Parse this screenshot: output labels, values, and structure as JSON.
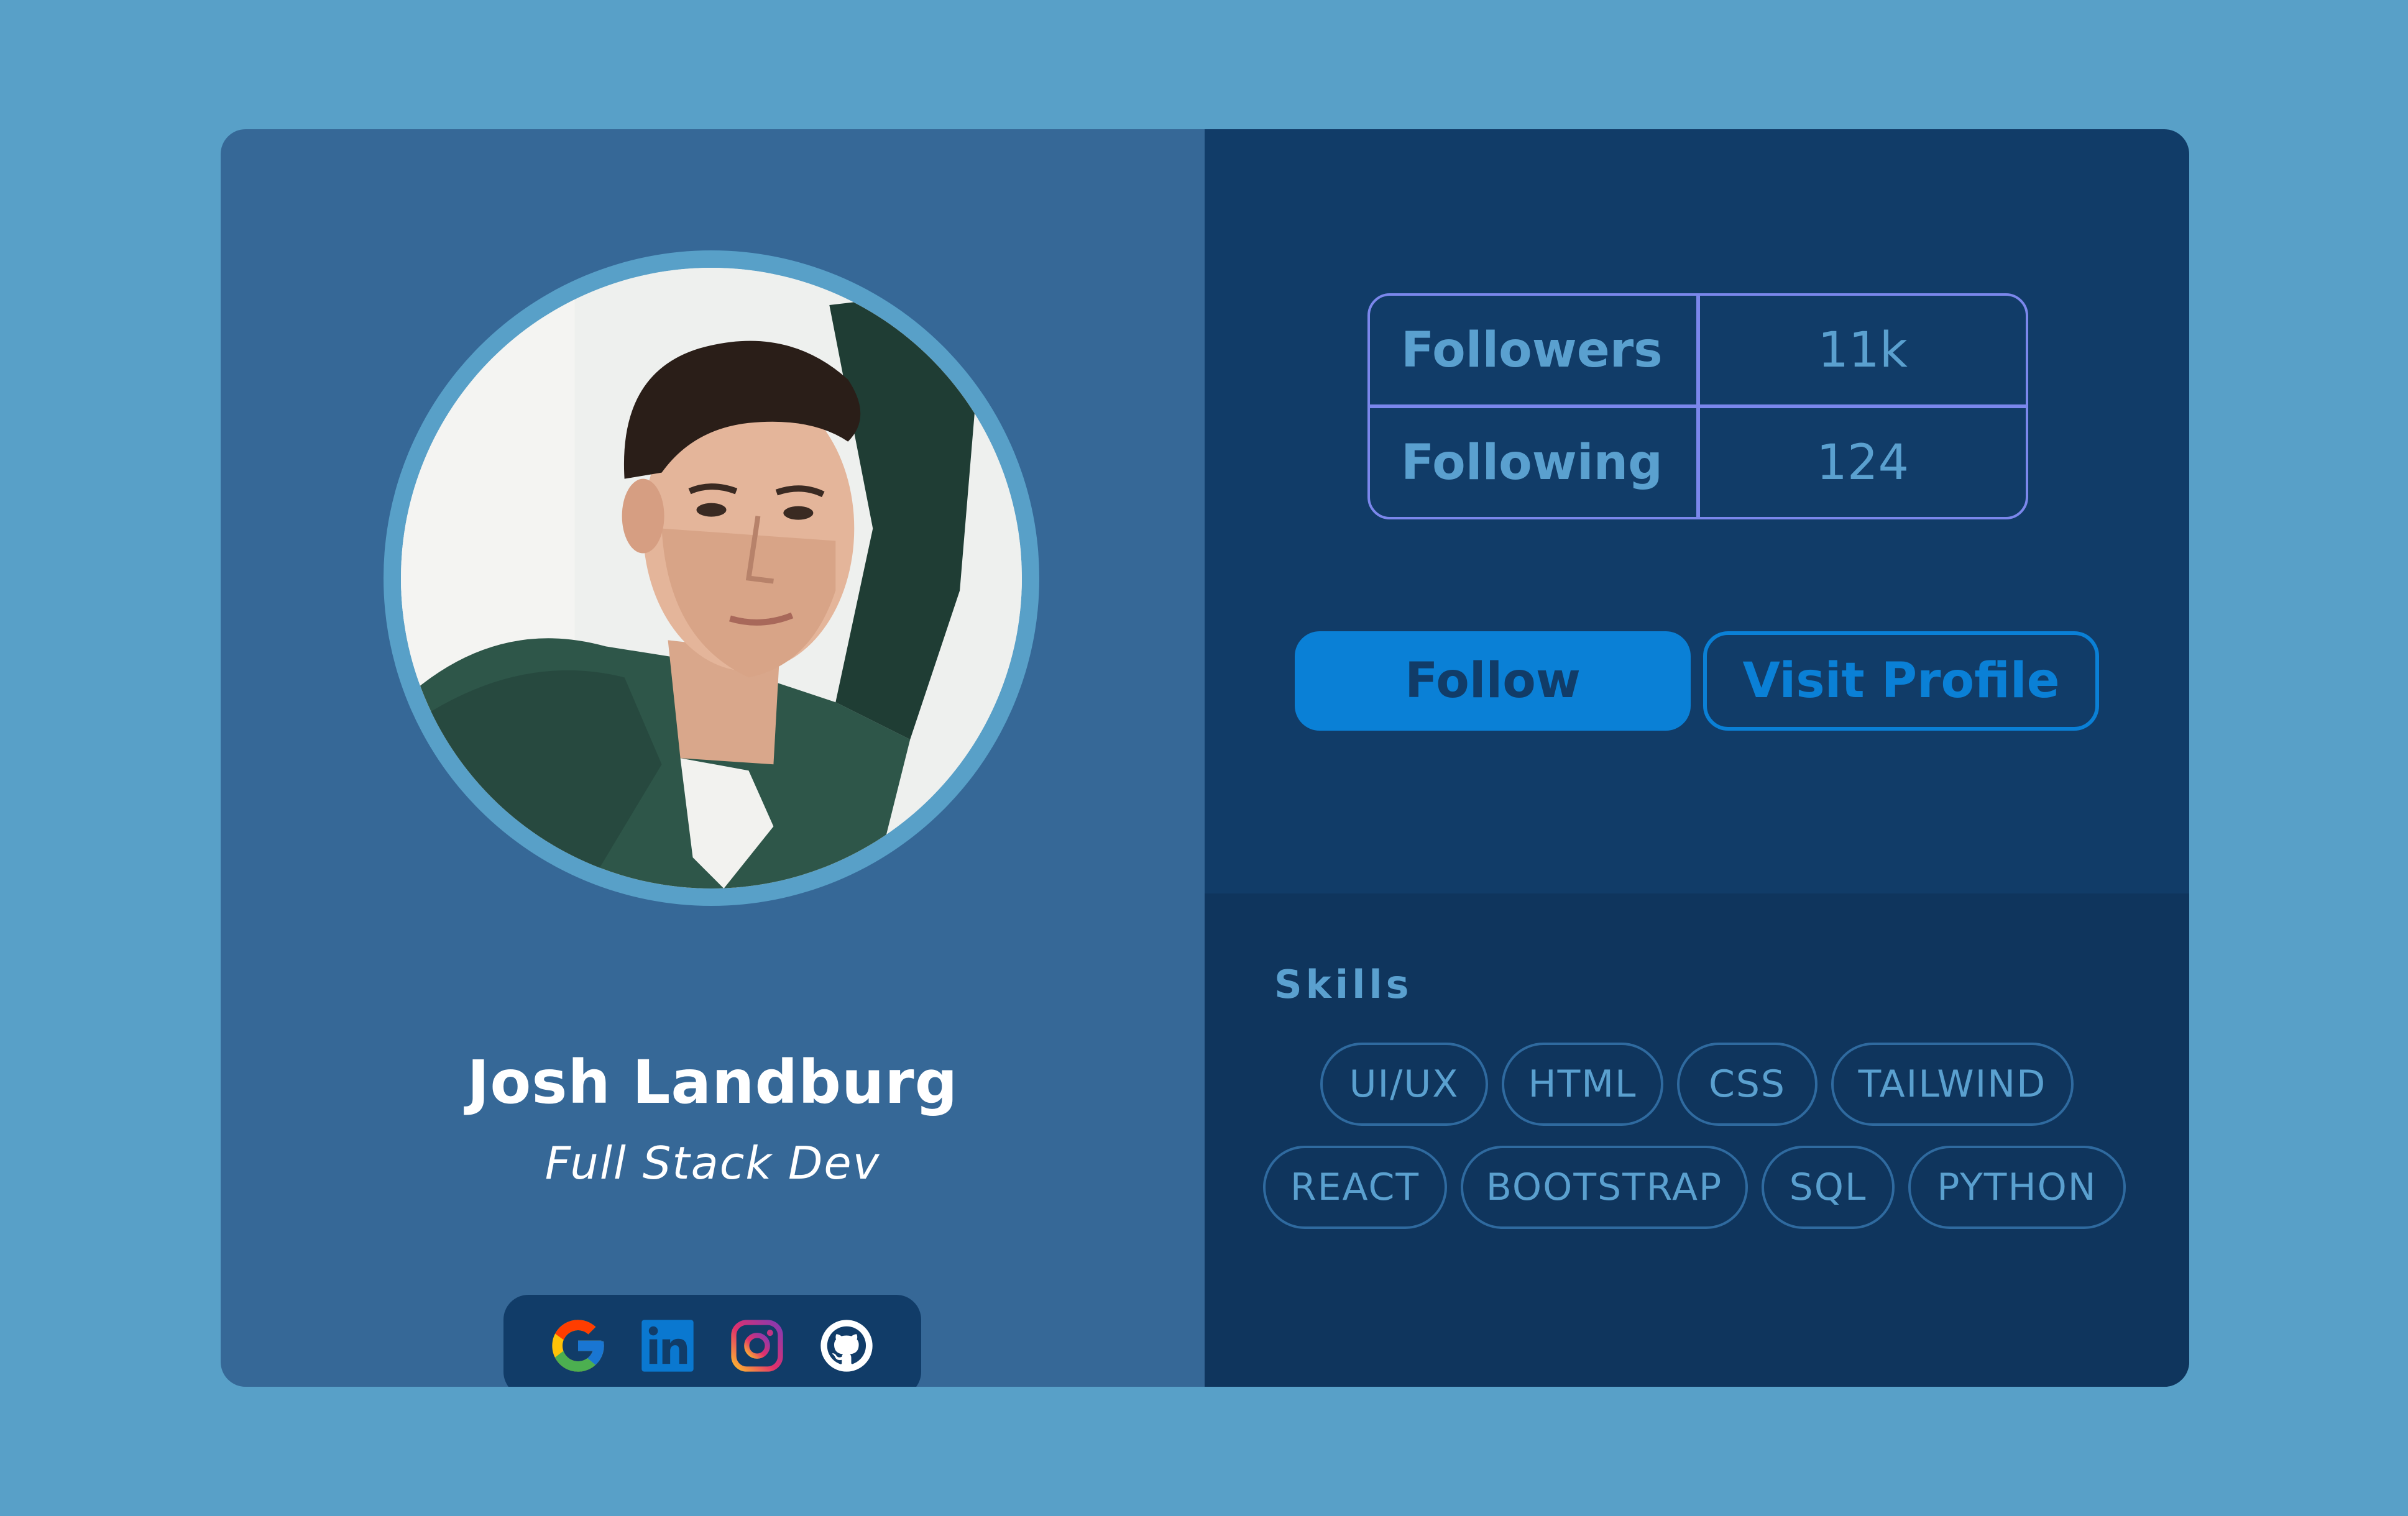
{
  "profile": {
    "name": "Josh Landburg",
    "role": "Full Stack Dev"
  },
  "social_links": [
    {
      "icon": "google-icon",
      "label": "Google"
    },
    {
      "icon": "linkedin-icon",
      "label": "LinkedIn"
    },
    {
      "icon": "instagram-icon",
      "label": "Instagram"
    },
    {
      "icon": "github-icon",
      "label": "GitHub"
    }
  ],
  "stats": {
    "followers_label": "Followers",
    "followers_value": "11k",
    "following_label": "Following",
    "following_value": "124"
  },
  "actions": {
    "follow_label": "Follow",
    "visit_label": "Visit Profile"
  },
  "skills": {
    "title": "Skills",
    "tags": [
      "UI/UX",
      "HTML",
      "CSS",
      "TAILWIND",
      "REACT",
      "BOOTSTRAP",
      "SQL",
      "PYTHON"
    ]
  },
  "colors": {
    "page_background": "#58a0c8",
    "left_panel": "#366897",
    "right_panel": "#113c68",
    "accent": "#0a80d6",
    "table_border": "#7b87ec",
    "muted_text": "#5aa0cf"
  }
}
